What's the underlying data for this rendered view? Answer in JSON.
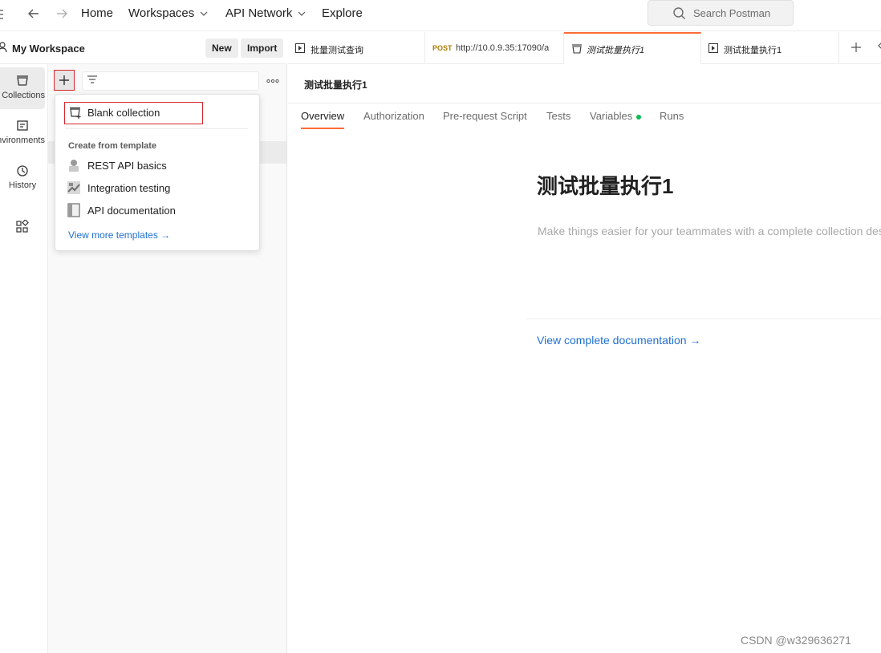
{
  "topbar": {
    "home": "Home",
    "workspaces": "Workspaces",
    "api_network": "API Network",
    "explore": "Explore",
    "search_placeholder": "Search Postman"
  },
  "workspace": {
    "name": "My Workspace",
    "new_label": "New",
    "import_label": "Import"
  },
  "rail": {
    "collections": "Collections",
    "environments": "Environments",
    "history": "History"
  },
  "dropdown": {
    "blank_collection": "Blank collection",
    "section_title": "Create from template",
    "templates": [
      {
        "label": "REST API basics"
      },
      {
        "label": "Integration testing"
      },
      {
        "label": "API documentation"
      }
    ],
    "view_more": "View more templates →"
  },
  "tabs": [
    {
      "label": "批量测试查询"
    },
    {
      "method": "POST",
      "url": "http://10.0.9.35:17090/a"
    },
    {
      "label": "测试批量执行1"
    },
    {
      "label": "测试批量执行1"
    }
  ],
  "main": {
    "crumb": "测试批量执行1",
    "subtabs": [
      "Overview",
      "Authorization",
      "Pre-request Script",
      "Tests",
      "Variables",
      "Runs"
    ],
    "title": "测试批量执行1",
    "description": "Make things easier for your teammates with a complete collection description.",
    "doc_link": "View complete documentation →"
  },
  "watermark": "CSDN @w329636271",
  "colors": {
    "accent": "#ff6c37",
    "highlight_box": "#d6272c",
    "link": "#1f6fd1",
    "status_dot": "#0cbb52"
  }
}
